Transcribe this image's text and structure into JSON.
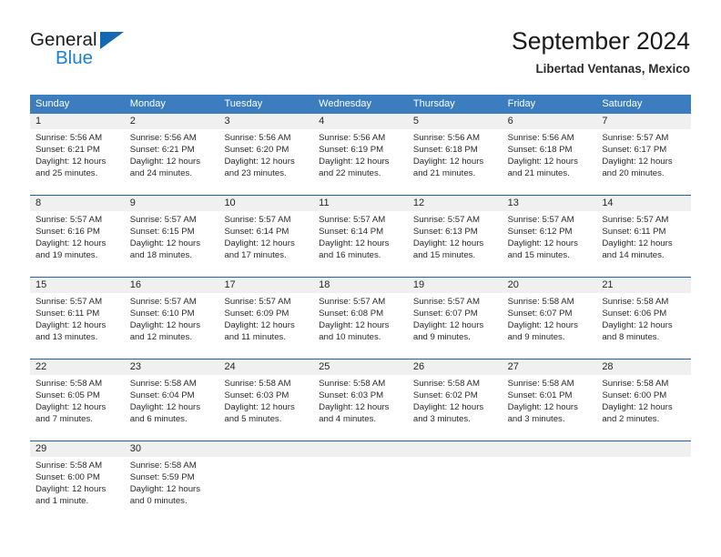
{
  "brand": {
    "name_top": "General",
    "name_bottom": "Blue",
    "triangle_icon": "triangle-icon",
    "color_top": "#1b1b1b",
    "color_bottom": "#1b7fd4",
    "triangle_color": "#1268b3"
  },
  "header": {
    "title": "September 2024",
    "subtitle": "Libertad Ventanas, Mexico"
  },
  "theme": {
    "header_bg": "#3b7dbf",
    "header_text": "#ffffff",
    "row_separator": "#1b64ac",
    "day_band_bg": "#f0f0f0",
    "body_text": "#2a2a2a"
  },
  "weekday_headers": [
    "Sunday",
    "Monday",
    "Tuesday",
    "Wednesday",
    "Thursday",
    "Friday",
    "Saturday"
  ],
  "weeks": [
    [
      {
        "day": "1",
        "lines": [
          "Sunrise: 5:56 AM",
          "Sunset: 6:21 PM",
          "Daylight: 12 hours",
          "and 25 minutes."
        ]
      },
      {
        "day": "2",
        "lines": [
          "Sunrise: 5:56 AM",
          "Sunset: 6:21 PM",
          "Daylight: 12 hours",
          "and 24 minutes."
        ]
      },
      {
        "day": "3",
        "lines": [
          "Sunrise: 5:56 AM",
          "Sunset: 6:20 PM",
          "Daylight: 12 hours",
          "and 23 minutes."
        ]
      },
      {
        "day": "4",
        "lines": [
          "Sunrise: 5:56 AM",
          "Sunset: 6:19 PM",
          "Daylight: 12 hours",
          "and 22 minutes."
        ]
      },
      {
        "day": "5",
        "lines": [
          "Sunrise: 5:56 AM",
          "Sunset: 6:18 PM",
          "Daylight: 12 hours",
          "and 21 minutes."
        ]
      },
      {
        "day": "6",
        "lines": [
          "Sunrise: 5:56 AM",
          "Sunset: 6:18 PM",
          "Daylight: 12 hours",
          "and 21 minutes."
        ]
      },
      {
        "day": "7",
        "lines": [
          "Sunrise: 5:57 AM",
          "Sunset: 6:17 PM",
          "Daylight: 12 hours",
          "and 20 minutes."
        ]
      }
    ],
    [
      {
        "day": "8",
        "lines": [
          "Sunrise: 5:57 AM",
          "Sunset: 6:16 PM",
          "Daylight: 12 hours",
          "and 19 minutes."
        ]
      },
      {
        "day": "9",
        "lines": [
          "Sunrise: 5:57 AM",
          "Sunset: 6:15 PM",
          "Daylight: 12 hours",
          "and 18 minutes."
        ]
      },
      {
        "day": "10",
        "lines": [
          "Sunrise: 5:57 AM",
          "Sunset: 6:14 PM",
          "Daylight: 12 hours",
          "and 17 minutes."
        ]
      },
      {
        "day": "11",
        "lines": [
          "Sunrise: 5:57 AM",
          "Sunset: 6:14 PM",
          "Daylight: 12 hours",
          "and 16 minutes."
        ]
      },
      {
        "day": "12",
        "lines": [
          "Sunrise: 5:57 AM",
          "Sunset: 6:13 PM",
          "Daylight: 12 hours",
          "and 15 minutes."
        ]
      },
      {
        "day": "13",
        "lines": [
          "Sunrise: 5:57 AM",
          "Sunset: 6:12 PM",
          "Daylight: 12 hours",
          "and 15 minutes."
        ]
      },
      {
        "day": "14",
        "lines": [
          "Sunrise: 5:57 AM",
          "Sunset: 6:11 PM",
          "Daylight: 12 hours",
          "and 14 minutes."
        ]
      }
    ],
    [
      {
        "day": "15",
        "lines": [
          "Sunrise: 5:57 AM",
          "Sunset: 6:11 PM",
          "Daylight: 12 hours",
          "and 13 minutes."
        ]
      },
      {
        "day": "16",
        "lines": [
          "Sunrise: 5:57 AM",
          "Sunset: 6:10 PM",
          "Daylight: 12 hours",
          "and 12 minutes."
        ]
      },
      {
        "day": "17",
        "lines": [
          "Sunrise: 5:57 AM",
          "Sunset: 6:09 PM",
          "Daylight: 12 hours",
          "and 11 minutes."
        ]
      },
      {
        "day": "18",
        "lines": [
          "Sunrise: 5:57 AM",
          "Sunset: 6:08 PM",
          "Daylight: 12 hours",
          "and 10 minutes."
        ]
      },
      {
        "day": "19",
        "lines": [
          "Sunrise: 5:57 AM",
          "Sunset: 6:07 PM",
          "Daylight: 12 hours",
          "and 9 minutes."
        ]
      },
      {
        "day": "20",
        "lines": [
          "Sunrise: 5:58 AM",
          "Sunset: 6:07 PM",
          "Daylight: 12 hours",
          "and 9 minutes."
        ]
      },
      {
        "day": "21",
        "lines": [
          "Sunrise: 5:58 AM",
          "Sunset: 6:06 PM",
          "Daylight: 12 hours",
          "and 8 minutes."
        ]
      }
    ],
    [
      {
        "day": "22",
        "lines": [
          "Sunrise: 5:58 AM",
          "Sunset: 6:05 PM",
          "Daylight: 12 hours",
          "and 7 minutes."
        ]
      },
      {
        "day": "23",
        "lines": [
          "Sunrise: 5:58 AM",
          "Sunset: 6:04 PM",
          "Daylight: 12 hours",
          "and 6 minutes."
        ]
      },
      {
        "day": "24",
        "lines": [
          "Sunrise: 5:58 AM",
          "Sunset: 6:03 PM",
          "Daylight: 12 hours",
          "and 5 minutes."
        ]
      },
      {
        "day": "25",
        "lines": [
          "Sunrise: 5:58 AM",
          "Sunset: 6:03 PM",
          "Daylight: 12 hours",
          "and 4 minutes."
        ]
      },
      {
        "day": "26",
        "lines": [
          "Sunrise: 5:58 AM",
          "Sunset: 6:02 PM",
          "Daylight: 12 hours",
          "and 3 minutes."
        ]
      },
      {
        "day": "27",
        "lines": [
          "Sunrise: 5:58 AM",
          "Sunset: 6:01 PM",
          "Daylight: 12 hours",
          "and 3 minutes."
        ]
      },
      {
        "day": "28",
        "lines": [
          "Sunrise: 5:58 AM",
          "Sunset: 6:00 PM",
          "Daylight: 12 hours",
          "and 2 minutes."
        ]
      }
    ],
    [
      {
        "day": "29",
        "lines": [
          "Sunrise: 5:58 AM",
          "Sunset: 6:00 PM",
          "Daylight: 12 hours",
          "and 1 minute."
        ]
      },
      {
        "day": "30",
        "lines": [
          "Sunrise: 5:58 AM",
          "Sunset: 5:59 PM",
          "Daylight: 12 hours",
          "and 0 minutes."
        ]
      },
      {
        "day": "",
        "lines": []
      },
      {
        "day": "",
        "lines": []
      },
      {
        "day": "",
        "lines": []
      },
      {
        "day": "",
        "lines": []
      },
      {
        "day": "",
        "lines": []
      }
    ]
  ]
}
